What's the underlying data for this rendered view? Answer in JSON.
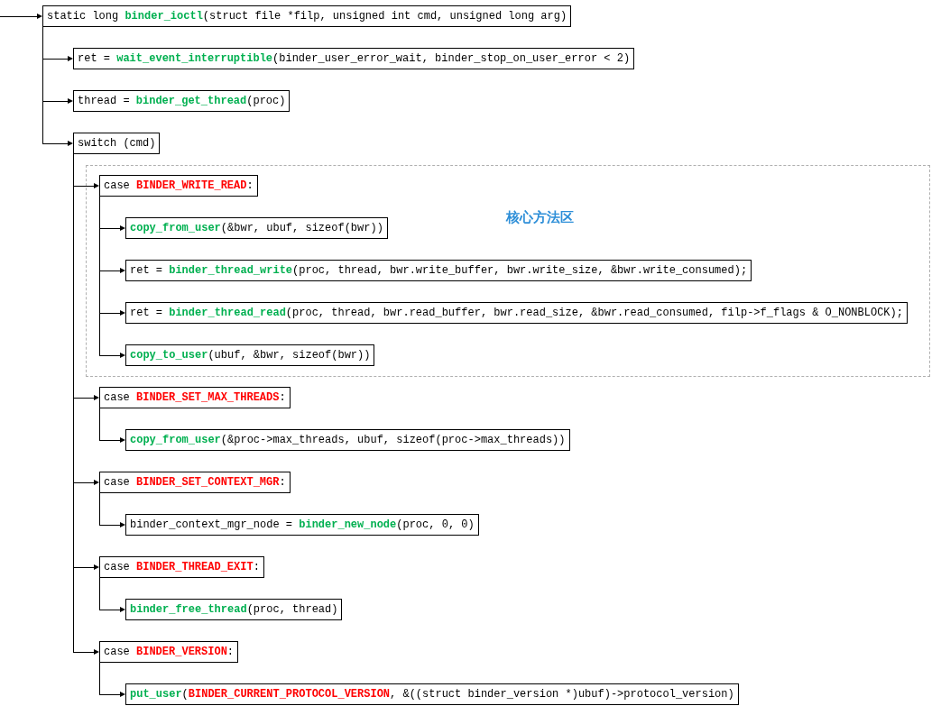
{
  "root": {
    "parts": [
      {
        "kind": "plain",
        "text": "static long "
      },
      {
        "kind": "func",
        "text": "binder_ioctl"
      },
      {
        "kind": "plain",
        "text": "(struct file *filp, unsigned int cmd, unsigned long arg)"
      }
    ],
    "children": [
      {
        "parts": [
          {
            "kind": "plain",
            "text": "ret = "
          },
          {
            "kind": "func",
            "text": "wait_event_interruptible"
          },
          {
            "kind": "plain",
            "text": "(binder_user_error_wait, binder_stop_on_user_error < 2)"
          }
        ]
      },
      {
        "parts": [
          {
            "kind": "plain",
            "text": "thread = "
          },
          {
            "kind": "func",
            "text": "binder_get_thread"
          },
          {
            "kind": "plain",
            "text": "(proc)"
          }
        ]
      },
      {
        "parts": [
          {
            "kind": "plain",
            "text": "switch (cmd)"
          }
        ],
        "children": [
          {
            "group_label": "核心方法区",
            "parts": [
              {
                "kind": "plain",
                "text": "case "
              },
              {
                "kind": "const",
                "text": "BINDER_WRITE_READ"
              },
              {
                "kind": "plain",
                "text": ":"
              }
            ],
            "children": [
              {
                "parts": [
                  {
                    "kind": "func",
                    "text": "copy_from_user"
                  },
                  {
                    "kind": "plain",
                    "text": "(&bwr, ubuf, sizeof(bwr))"
                  }
                ]
              },
              {
                "parts": [
                  {
                    "kind": "plain",
                    "text": "ret = "
                  },
                  {
                    "kind": "func",
                    "text": "binder_thread_write"
                  },
                  {
                    "kind": "plain",
                    "text": "(proc, thread, bwr.write_buffer, bwr.write_size, &bwr.write_consumed);"
                  }
                ]
              },
              {
                "parts": [
                  {
                    "kind": "plain",
                    "text": "ret = "
                  },
                  {
                    "kind": "func",
                    "text": "binder_thread_read"
                  },
                  {
                    "kind": "plain",
                    "text": "(proc, thread, bwr.read_buffer, bwr.read_size, &bwr.read_consumed, filp->f_flags & O_NONBLOCK);"
                  }
                ]
              },
              {
                "parts": [
                  {
                    "kind": "func",
                    "text": "copy_to_user"
                  },
                  {
                    "kind": "plain",
                    "text": "(ubuf, &bwr, sizeof(bwr))"
                  }
                ]
              }
            ]
          },
          {
            "parts": [
              {
                "kind": "plain",
                "text": "case "
              },
              {
                "kind": "const",
                "text": "BINDER_SET_MAX_THREADS"
              },
              {
                "kind": "plain",
                "text": ":"
              }
            ],
            "children": [
              {
                "parts": [
                  {
                    "kind": "func",
                    "text": "copy_from_user"
                  },
                  {
                    "kind": "plain",
                    "text": "(&proc->max_threads, ubuf, sizeof(proc->max_threads))"
                  }
                ]
              }
            ]
          },
          {
            "parts": [
              {
                "kind": "plain",
                "text": "case "
              },
              {
                "kind": "const",
                "text": "BINDER_SET_CONTEXT_MGR"
              },
              {
                "kind": "plain",
                "text": ":"
              }
            ],
            "children": [
              {
                "parts": [
                  {
                    "kind": "plain",
                    "text": "binder_context_mgr_node = "
                  },
                  {
                    "kind": "func",
                    "text": "binder_new_node"
                  },
                  {
                    "kind": "plain",
                    "text": "(proc, 0, 0)"
                  }
                ]
              }
            ]
          },
          {
            "parts": [
              {
                "kind": "plain",
                "text": "case "
              },
              {
                "kind": "const",
                "text": "BINDER_THREAD_EXIT"
              },
              {
                "kind": "plain",
                "text": ":"
              }
            ],
            "children": [
              {
                "parts": [
                  {
                    "kind": "func",
                    "text": "binder_free_thread"
                  },
                  {
                    "kind": "plain",
                    "text": "(proc, thread)"
                  }
                ]
              }
            ]
          },
          {
            "parts": [
              {
                "kind": "plain",
                "text": "case "
              },
              {
                "kind": "const",
                "text": "BINDER_VERSION"
              },
              {
                "kind": "plain",
                "text": ":"
              }
            ],
            "children": [
              {
                "parts": [
                  {
                    "kind": "func",
                    "text": "put_user"
                  },
                  {
                    "kind": "plain",
                    "text": "("
                  },
                  {
                    "kind": "const",
                    "text": "BINDER_CURRENT_PROTOCOL_VERSION"
                  },
                  {
                    "kind": "plain",
                    "text": ", &((struct binder_version *)ubuf)->protocol_version)"
                  }
                ]
              }
            ]
          }
        ]
      }
    ]
  }
}
